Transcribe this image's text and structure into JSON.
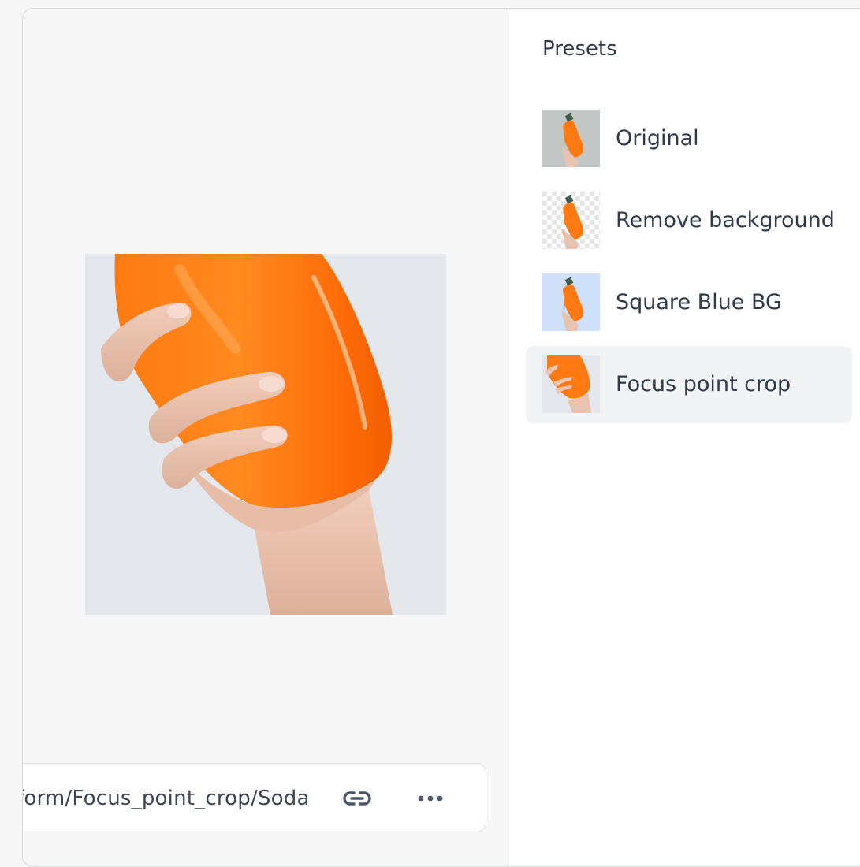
{
  "preview": {
    "image_icon": "orange-soda-bottle-in-hand-image",
    "background_color": "#e4e7eb"
  },
  "url_bar": {
    "text": "form/Focus_point_crop/Soda",
    "link_icon": "link-icon",
    "more_icon": "more-horizontal-icon"
  },
  "presets": {
    "title": "Presets",
    "items": [
      {
        "label": "Original",
        "thumb": "original-thumbnail",
        "active": false
      },
      {
        "label": "Remove background",
        "thumb": "transparent-background-thumbnail",
        "active": false
      },
      {
        "label": "Square Blue BG",
        "thumb": "blue-background-thumbnail",
        "active": false
      },
      {
        "label": "Focus point crop",
        "thumb": "focus-crop-thumbnail",
        "active": true
      }
    ]
  },
  "colors": {
    "accent_orange": "#ff7a1a",
    "selected_row": "#f2f3f5",
    "blue_bg": "#cfe0fb"
  }
}
